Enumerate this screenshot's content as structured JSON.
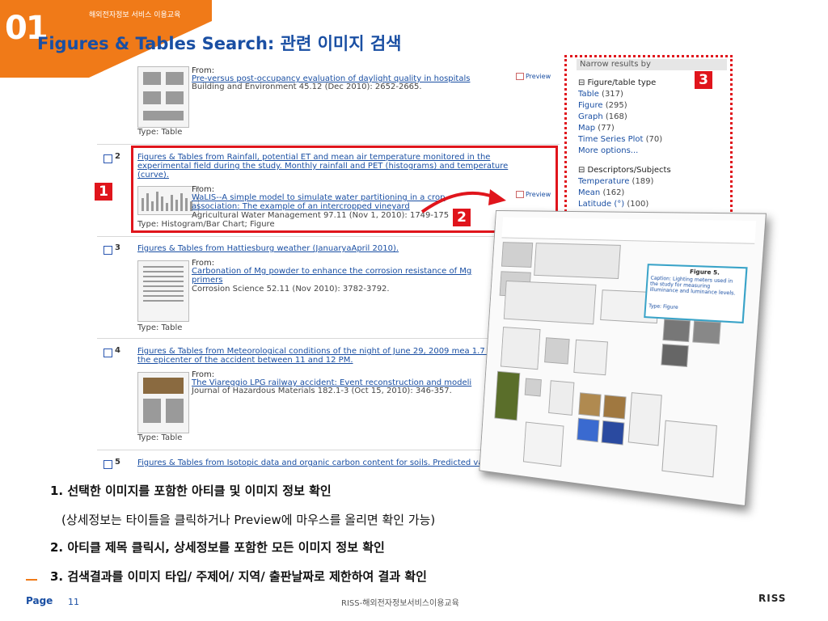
{
  "header": {
    "number": "01",
    "subtitle": "해외전자정보 서비스 이용교육",
    "title": "Figures & Tables Search: 관련 이미지 검색"
  },
  "results": [
    {
      "number": "",
      "title": "",
      "from_label": "From:",
      "article": "Pre-versus post-occupancy evaluation of daylight quality in hospitals",
      "meta": "Building and Environment 45.12 (Dec 2010): 2652-2665.",
      "type": "Type: Table",
      "preview": "Preview"
    },
    {
      "number": "2",
      "title": "Figures & Tables from Rainfall, potential ET and mean air temperature monitored in the experimental field during the study. Monthly rainfall and PET (histograms) and temperature (curve).",
      "from_label": "From:",
      "article": "WaLIS--A simple model to simulate water partitioning in a crop association: The example of an intercropped vineyard",
      "meta": "Agricultural Water Management 97.11 (Nov 1, 2010): 1749-175",
      "type": "Type: Histogram/Bar Chart; Figure",
      "preview": "Preview"
    },
    {
      "number": "3",
      "title": "Figures & Tables from Hattiesburg weather (JanuaryaApril 2010).",
      "from_label": "From:",
      "article": "Carbonation of Mg powder to enhance the corrosion resistance of Mg primers",
      "meta": "Corrosion Science 52.11 (Nov 2010): 3782-3792.",
      "type": "Type: Table",
      "preview": ""
    },
    {
      "number": "4",
      "title": "Figures & Tables from Meteorological conditions of the night of June 29, 2009 mea 1.7 km from the epicenter of the accident between 11 and 12 PM.",
      "from_label": "From:",
      "article": "The Viareggio LPG railway accident: Event reconstruction and modeli",
      "meta": "Journal of Hazardous Materials 182.1-3 (Oct 15, 2010): 346-357.",
      "type": "Type: Table",
      "preview": ""
    },
    {
      "number": "5",
      "title": "Figures & Tables from Isotopic data and organic carbon content for soils. Predicted values",
      "from_label": "",
      "article": "",
      "meta": "",
      "type": "",
      "preview": ""
    }
  ],
  "sidebar": {
    "heading": "Narrow results by",
    "group1_heading": "⊟ Figure/table type",
    "group1": [
      {
        "label": "Table",
        "count": "(317)"
      },
      {
        "label": "Figure",
        "count": "(295)"
      },
      {
        "label": "Graph",
        "count": "(168)"
      },
      {
        "label": "Map",
        "count": "(77)"
      },
      {
        "label": "Time Series Plot",
        "count": "(70)"
      }
    ],
    "more": "More options...",
    "group2_heading": "⊟ Descriptors/Subjects",
    "group2": [
      {
        "label": "Temperature",
        "count": "(189)"
      },
      {
        "label": "Mean",
        "count": "(162)"
      },
      {
        "label": "Latitude (°)",
        "count": "(100)"
      }
    ]
  },
  "overlay": {
    "caption_title": "Figure 5.",
    "caption_text": "Caption: Lighting meters used in the study for measuring illuminance and luminance levels.",
    "caption_type": "Type: Figure"
  },
  "badges": {
    "b1": "1",
    "b2": "2",
    "b3": "3"
  },
  "instructions": {
    "line1": "1. 선택한 이미지를 포함한 아티클 및 이미지 정보 확인",
    "line1b": "(상세정보는 타이틀을 클릭하거나 Preview에 마우스를 올리면 확인 가능)",
    "line2": "2. 아티클 제목 클릭시, 상세정보를 포함한 모든 이미지 정보 확인",
    "line3": "3. 검색결과를 이미지 타입/ 주제어/ 지역/ 출판날짜로 제한하여 결과 확인"
  },
  "footer": {
    "page_label": "Page",
    "page_number": "11",
    "center": "RISS-해외전자정보서비스이용교육",
    "logo": "RISS"
  },
  "colors": {
    "accent": "#f07a18",
    "link": "#1a4fa3",
    "highlight": "#e0151c"
  }
}
